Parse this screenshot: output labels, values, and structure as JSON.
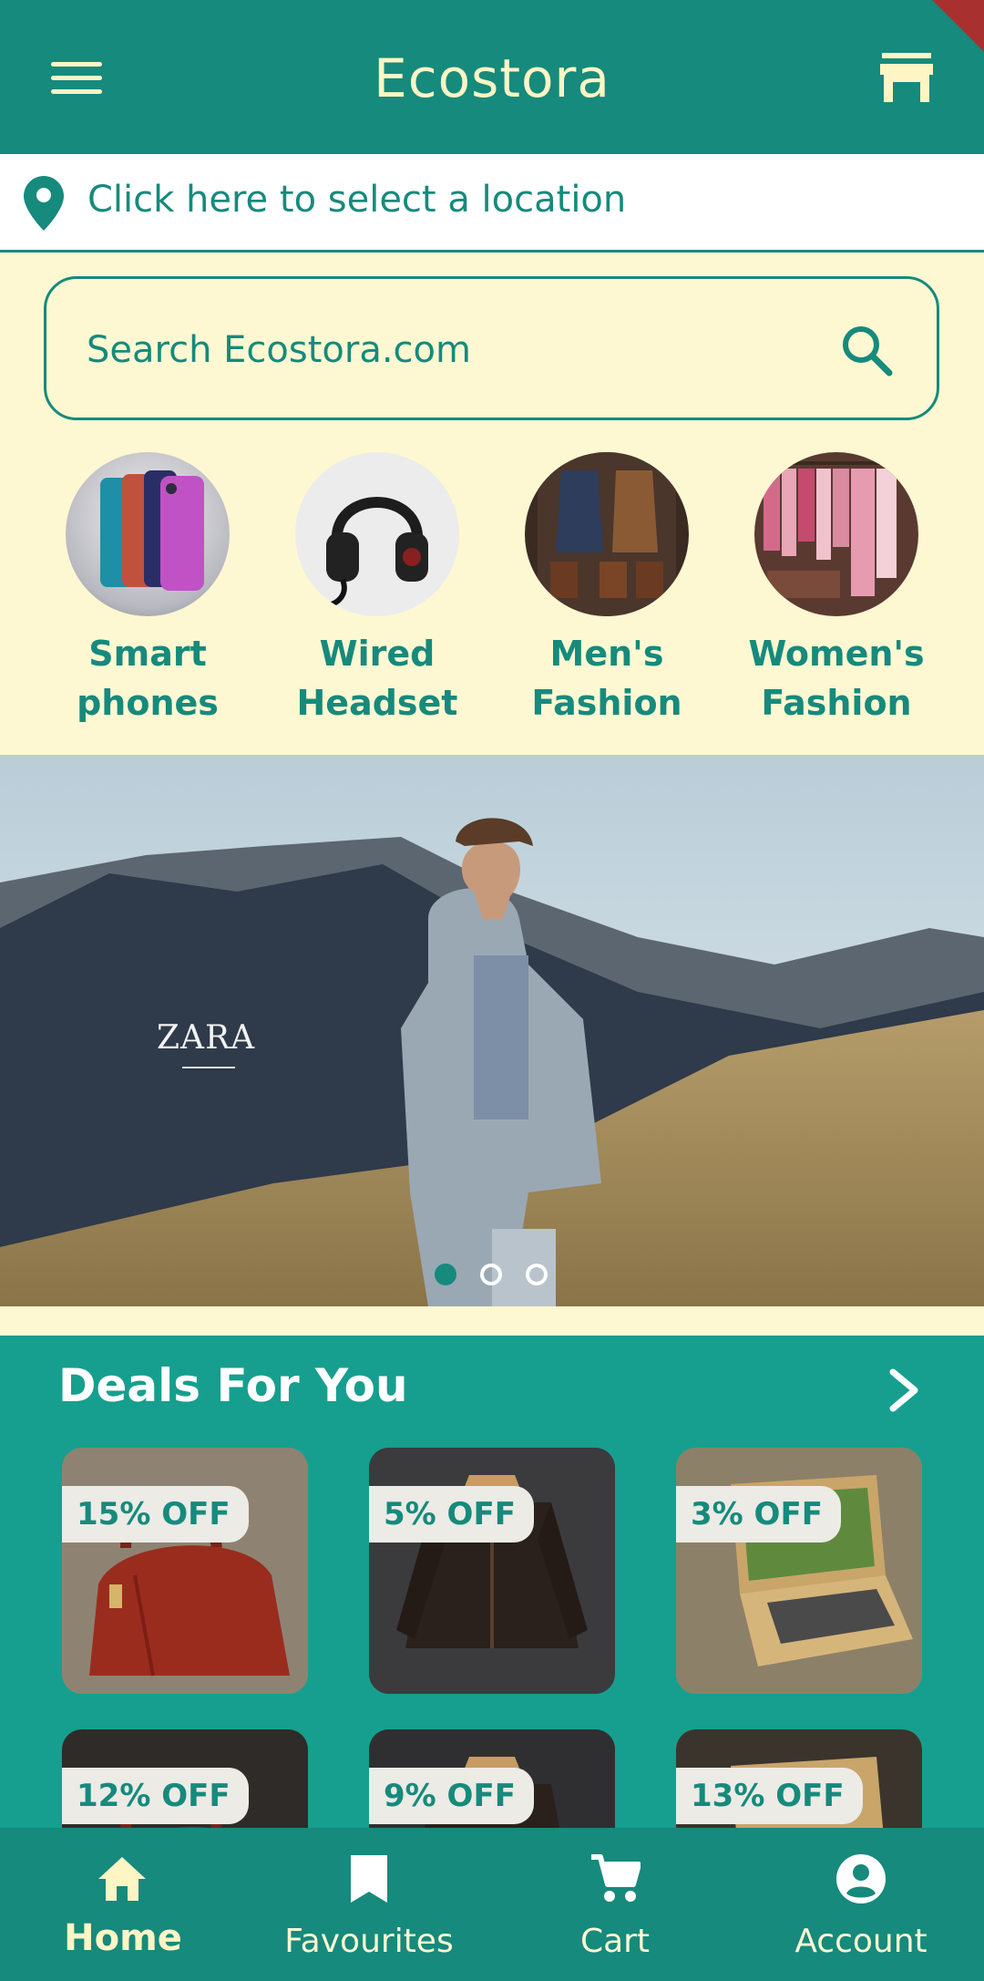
{
  "app": {
    "title": "Ecostora"
  },
  "location": {
    "label": "Click here to select a location"
  },
  "search": {
    "placeholder": "Search Ecostora.com"
  },
  "categories": [
    {
      "label": "Smart\nphones",
      "icon": "smartphones-image"
    },
    {
      "label": "Wired\nHeadset",
      "icon": "headset-image"
    },
    {
      "label": "Men's\nFashion",
      "icon": "mens-fashion-image"
    },
    {
      "label": "Women's\nFashion",
      "icon": "womens-fashion-image"
    }
  ],
  "banner": {
    "brand": "ZARA",
    "slides": 3,
    "active_slide": 1
  },
  "deals": {
    "title": "Deals For You",
    "items": [
      {
        "discount": "15% OFF",
        "product": "handbag"
      },
      {
        "discount": "5% OFF",
        "product": "leather-jacket"
      },
      {
        "discount": "3% OFF",
        "product": "laptop"
      },
      {
        "discount": "12% OFF",
        "product": "handbag"
      },
      {
        "discount": "9% OFF",
        "product": "leather-jacket"
      },
      {
        "discount": "13% OFF",
        "product": "laptop"
      }
    ]
  },
  "nav": {
    "items": [
      {
        "label": "Home",
        "icon": "home-icon",
        "active": true
      },
      {
        "label": "Favourites",
        "icon": "bookmark-icon",
        "active": false
      },
      {
        "label": "Cart",
        "icon": "cart-icon",
        "active": false
      },
      {
        "label": "Account",
        "icon": "account-icon",
        "active": false
      }
    ]
  },
  "colors": {
    "primary": "#168a7c",
    "deals_bg": "#169f8e",
    "cream": "#fdf8d2",
    "title_text": "#fdf5c4"
  }
}
